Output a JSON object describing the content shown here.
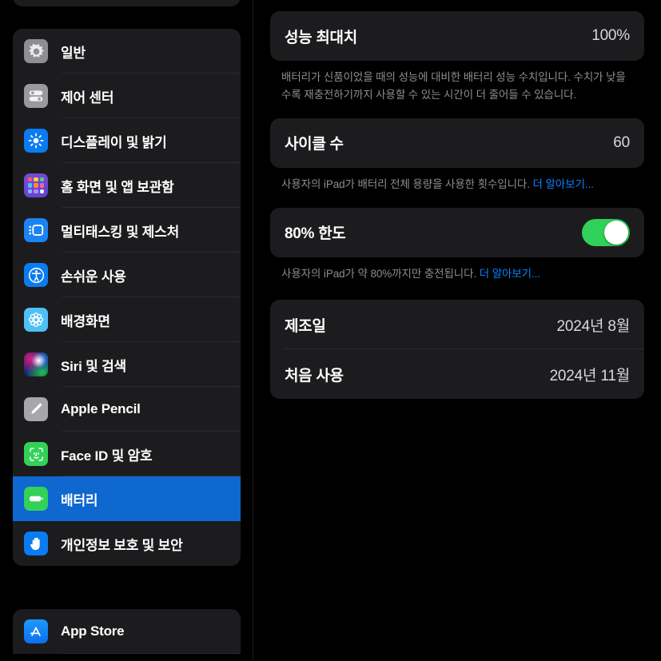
{
  "sidebar": {
    "groups": [
      {
        "name": "settings-primary-group",
        "items": [
          {
            "label": "일반",
            "icon": "gear-icon",
            "selected": false
          },
          {
            "label": "제어 센터",
            "icon": "control-center-icon",
            "selected": false
          },
          {
            "label": "디스플레이 및 밝기",
            "icon": "brightness-icon",
            "selected": false
          },
          {
            "label": "홈 화면 및 앱 보관함",
            "icon": "home-screen-icon",
            "selected": false
          },
          {
            "label": "멀티태스킹 및 제스처",
            "icon": "multitasking-icon",
            "selected": false
          },
          {
            "label": "손쉬운 사용",
            "icon": "accessibility-icon",
            "selected": false
          },
          {
            "label": "배경화면",
            "icon": "wallpaper-icon",
            "selected": false
          },
          {
            "label": "Siri 및 검색",
            "icon": "siri-icon",
            "selected": false
          },
          {
            "label": "Apple Pencil",
            "icon": "apple-pencil-icon",
            "selected": false
          },
          {
            "label": "Face ID 및 암호",
            "icon": "face-id-icon",
            "selected": false
          },
          {
            "label": "배터리",
            "icon": "battery-icon",
            "selected": true
          },
          {
            "label": "개인정보 보호 및 보안",
            "icon": "privacy-hand-icon",
            "selected": false
          }
        ]
      },
      {
        "name": "settings-secondary-group",
        "items": [
          {
            "label": "App Store",
            "icon": "app-store-icon",
            "selected": false
          }
        ]
      }
    ]
  },
  "main": {
    "sections": [
      {
        "id": "battery-health",
        "rows": [
          {
            "title": "성능 최대치",
            "value": "100%",
            "type": "value"
          }
        ],
        "footnote": {
          "text": "배터리가 신품이었을 때의 성능에 대비한 배터리 성능 수치입니다. 수치가 낮을수록 재충전하기까지 사용할 수 있는 시간이 더 줄어들 수 있습니다.",
          "link": ""
        }
      },
      {
        "id": "cycle-count",
        "rows": [
          {
            "title": "사이클 수",
            "value": "60",
            "type": "value"
          }
        ],
        "footnote": {
          "text": "사용자의 iPad가 배터리 전체 용량을 사용한 횟수입니다. ",
          "link": "더 알아보기..."
        }
      },
      {
        "id": "charge-limit",
        "rows": [
          {
            "title": "80% 한도",
            "value": "",
            "type": "toggle",
            "toggle_on": true
          }
        ],
        "footnote": {
          "text": "사용자의 iPad가 약 80%까지만 충전됩니다. ",
          "link": "더 알아보기..."
        }
      },
      {
        "id": "device-dates",
        "rows": [
          {
            "title": "제조일",
            "value": "2024년 8월",
            "type": "value"
          },
          {
            "title": "처음 사용",
            "value": "2024년 11월",
            "type": "value"
          }
        ],
        "footnote": null
      }
    ]
  },
  "colors": {
    "background": "#000000",
    "card": "#1c1c1e",
    "selection_blue": "#0e68cf",
    "link_blue": "#0a84ff",
    "toggle_green": "#30d158",
    "secondary_text": "#8d8d92"
  }
}
